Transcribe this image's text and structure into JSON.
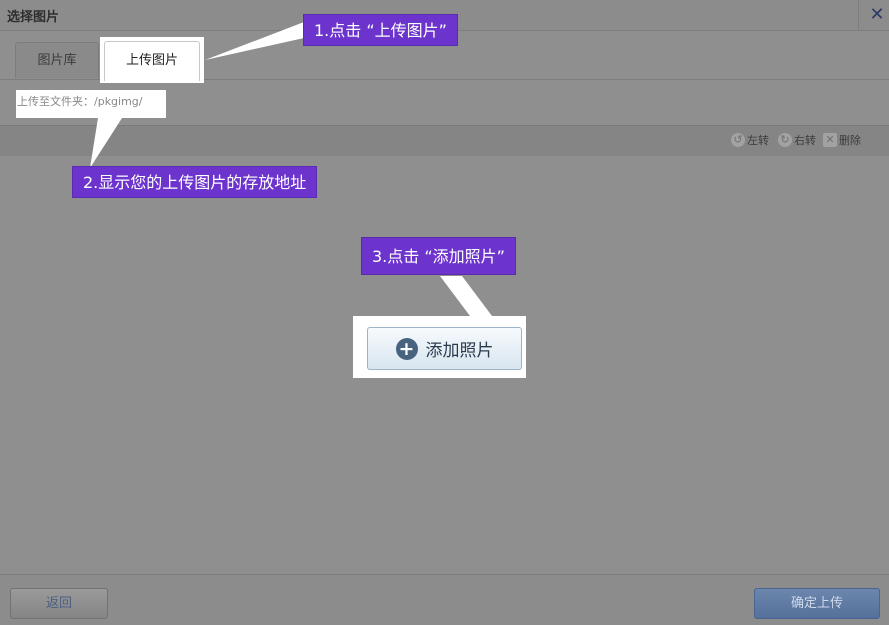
{
  "dialog": {
    "title": "选择图片",
    "close_glyph": "✕"
  },
  "tabs": [
    {
      "label": "图片库",
      "active": false
    },
    {
      "label": "上传图片",
      "active": true
    }
  ],
  "folder": {
    "label": "上传至文件夹：/pkgimg/"
  },
  "toolbar": {
    "rotate_left": "左转",
    "rotate_right": "右转",
    "delete": "删除"
  },
  "callouts": {
    "step1": "1.点击 “上传图片”",
    "step2": "2.显示您的上传图片的存放地址",
    "step3": "3.点击 “添加照片”"
  },
  "add_button": {
    "label": "添加照片",
    "icon": "plus-circle-icon"
  },
  "footer": {
    "back_label": "返回",
    "confirm_label": "确定上传"
  },
  "colors": {
    "callout_bg": "#6c34cc",
    "confirm_bg": "#5f7aa5",
    "dim_overlay": "#8f8f8f",
    "highlight": "#ffffff"
  }
}
